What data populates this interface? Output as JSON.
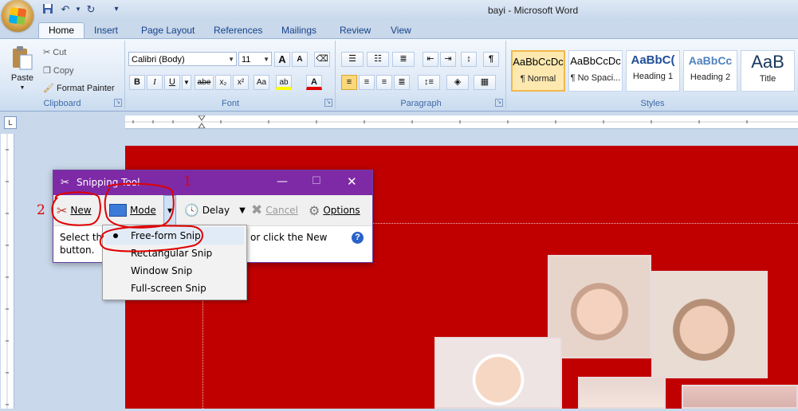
{
  "window": {
    "title": "bayi - Microsoft Word"
  },
  "quick_access": {
    "save": "save-icon",
    "undo": "undo-icon",
    "redo": "redo-icon"
  },
  "tabs": [
    "Home",
    "Insert",
    "Page Layout",
    "References",
    "Mailings",
    "Review",
    "View"
  ],
  "ribbon": {
    "clipboard": {
      "label": "Clipboard",
      "paste": "Paste",
      "cut": "Cut",
      "copy": "Copy",
      "format_painter": "Format Painter"
    },
    "font": {
      "label": "Font",
      "font_name": "Calibri (Body)",
      "font_size": "11",
      "bold": "B",
      "italic": "I",
      "underline": "U",
      "strike": "abe",
      "subscript": "x₂",
      "superscript": "x²",
      "grow": "A",
      "shrink": "A",
      "highlight": "ab",
      "font_color": "A"
    },
    "paragraph": {
      "label": "Paragraph",
      "pilcrow": "¶"
    },
    "styles": {
      "label": "Styles",
      "items": [
        {
          "preview": "AaBbCcDc",
          "name": "¶ Normal"
        },
        {
          "preview": "AaBbCcDc",
          "name": "¶ No Spaci..."
        },
        {
          "preview": "AaBbC(",
          "name": "Heading 1"
        },
        {
          "preview": "AaBbCc",
          "name": "Heading 2"
        },
        {
          "preview": "AaB",
          "name": "Title"
        }
      ]
    }
  },
  "snipping_tool": {
    "title": "Snipping Tool",
    "new": "New",
    "mode": "Mode",
    "delay": "Delay",
    "cancel": "Cancel",
    "options": "Options",
    "body_left": "Select the",
    "body_right": "or click the New",
    "body_line2": "button.",
    "help": "?"
  },
  "mode_menu": {
    "items": [
      "Free-form Snip",
      "Rectangular Snip",
      "Window Snip",
      "Full-screen Snip"
    ],
    "selected": "Free-form Snip"
  },
  "annotations": {
    "one": "1",
    "two": "2"
  },
  "colors": {
    "page_bg": "#c00000",
    "snip_titlebar": "#7e2aa6",
    "annotation": "#e00000"
  }
}
